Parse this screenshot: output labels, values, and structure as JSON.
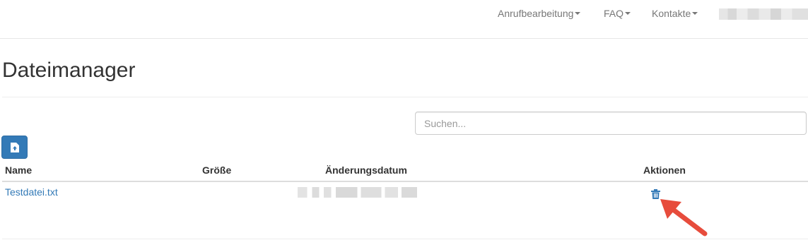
{
  "navbar": {
    "items": [
      {
        "label": "Anrufbearbeitung"
      },
      {
        "label": "FAQ"
      },
      {
        "label": "Kontakte"
      }
    ]
  },
  "page": {
    "title": "Dateimanager"
  },
  "search": {
    "placeholder": "Suchen...",
    "value": ""
  },
  "upload": {
    "icon": "file-upload-icon"
  },
  "table": {
    "columns": [
      "Name",
      "Größe",
      "Änderungsdatum",
      "Aktionen"
    ],
    "rows": [
      {
        "name": "Testdatei.txt",
        "size": "",
        "action_icon": "trash-icon"
      }
    ]
  },
  "colors": {
    "primary": "#337ab7",
    "link": "#337ab7",
    "annotation_arrow": "#e74c3c"
  }
}
